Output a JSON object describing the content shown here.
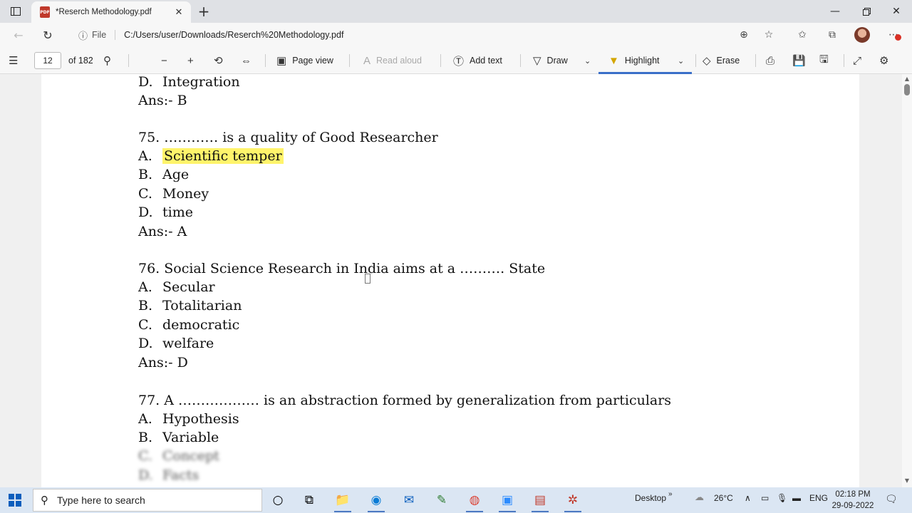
{
  "browser": {
    "tab_title": "*Reserch Methodology.pdf",
    "file_label": "File",
    "url": "C:/Users/user/Downloads/Reserch%20Methodology.pdf"
  },
  "pdf_toolbar": {
    "page_number": "12",
    "page_total": "of 182",
    "page_view": "Page view",
    "read_aloud": "Read aloud",
    "add_text": "Add text",
    "draw": "Draw",
    "highlight": "Highlight",
    "erase": "Erase"
  },
  "document": {
    "prev_tail": {
      "opt_label": "D.",
      "opt_text": "Integration",
      "answer": "Ans:- B"
    },
    "questions": [
      {
        "number_text": "75. ………… is a quality of Good Researcher",
        "options": [
          {
            "label": "A.",
            "text": "Scientific temper",
            "highlighted": true
          },
          {
            "label": "B.",
            "text": "Age"
          },
          {
            "label": "C.",
            "text": "Money"
          },
          {
            "label": "D.",
            "text": "time"
          }
        ],
        "answer": "Ans:- A"
      },
      {
        "number_text": "76. Social Science Research in India aims at a ………. State",
        "options": [
          {
            "label": "A.",
            "text": "Secular"
          },
          {
            "label": "B.",
            "text": "Totalitarian"
          },
          {
            "label": "C.",
            "text": "democratic"
          },
          {
            "label": "D.",
            "text": "welfare"
          }
        ],
        "answer": "Ans:- D"
      },
      {
        "number_text": "77. A ……………… is an abstraction formed by generalization from particulars",
        "options": [
          {
            "label": "A.",
            "text": "Hypothesis"
          },
          {
            "label": "B.",
            "text": "Variable"
          },
          {
            "label": "C.",
            "text": "Concept"
          },
          {
            "label": "D.",
            "text": "Facts"
          }
        ]
      }
    ]
  },
  "taskbar": {
    "search_placeholder": "Type here to search",
    "desktop_label": "Desktop",
    "weather": "26°C",
    "language": "ENG",
    "time": "02:18 PM",
    "date": "29-09-2022"
  },
  "colors": {
    "highlight": "#fff46b",
    "accent": "#3b6fc8",
    "pdf_icon": "#c0392b"
  }
}
